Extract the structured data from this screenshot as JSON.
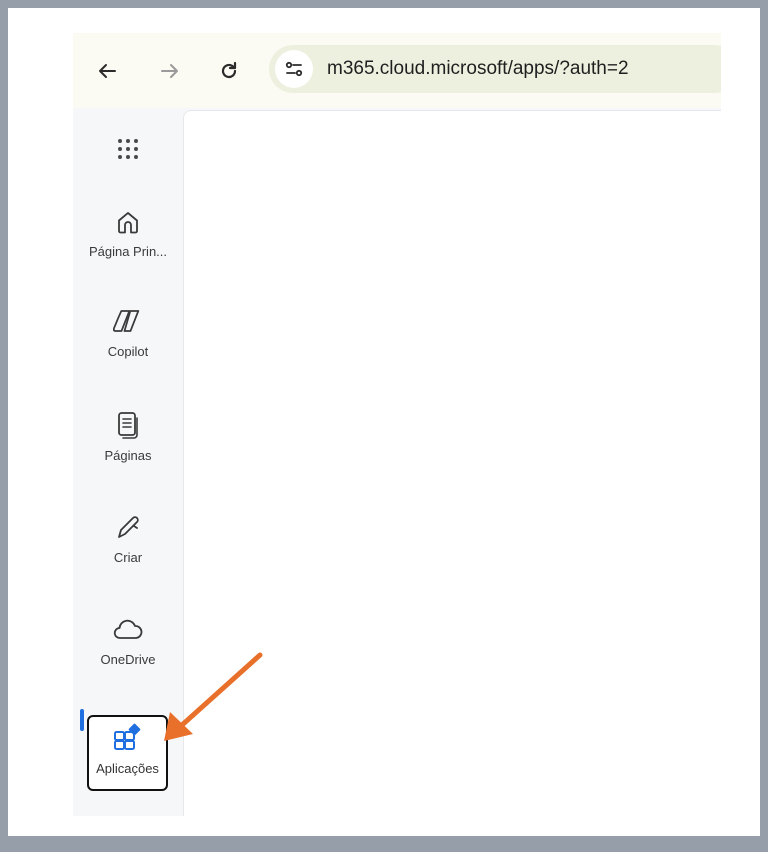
{
  "browser": {
    "url": "m365.cloud.microsoft/apps/?auth=2",
    "back_icon": "arrow-left-icon",
    "forward_icon": "arrow-right-icon",
    "reload_icon": "reload-icon",
    "site_info_icon": "tune-icon"
  },
  "sidebar": {
    "items": [
      {
        "label": "",
        "icon": "app-launcher-icon"
      },
      {
        "label": "Página Prin...",
        "icon": "home-icon"
      },
      {
        "label": "Copilot",
        "icon": "copilot-icon"
      },
      {
        "label": "Páginas",
        "icon": "pages-icon"
      },
      {
        "label": "Criar",
        "icon": "pen-icon"
      },
      {
        "label": "OneDrive",
        "icon": "cloud-icon"
      },
      {
        "label": "Aplicações",
        "icon": "apps-icon",
        "active": true
      }
    ]
  },
  "colors": {
    "accent": "#1f6fe0",
    "annotation_arrow": "#e8702a",
    "background": "#969ea9"
  }
}
